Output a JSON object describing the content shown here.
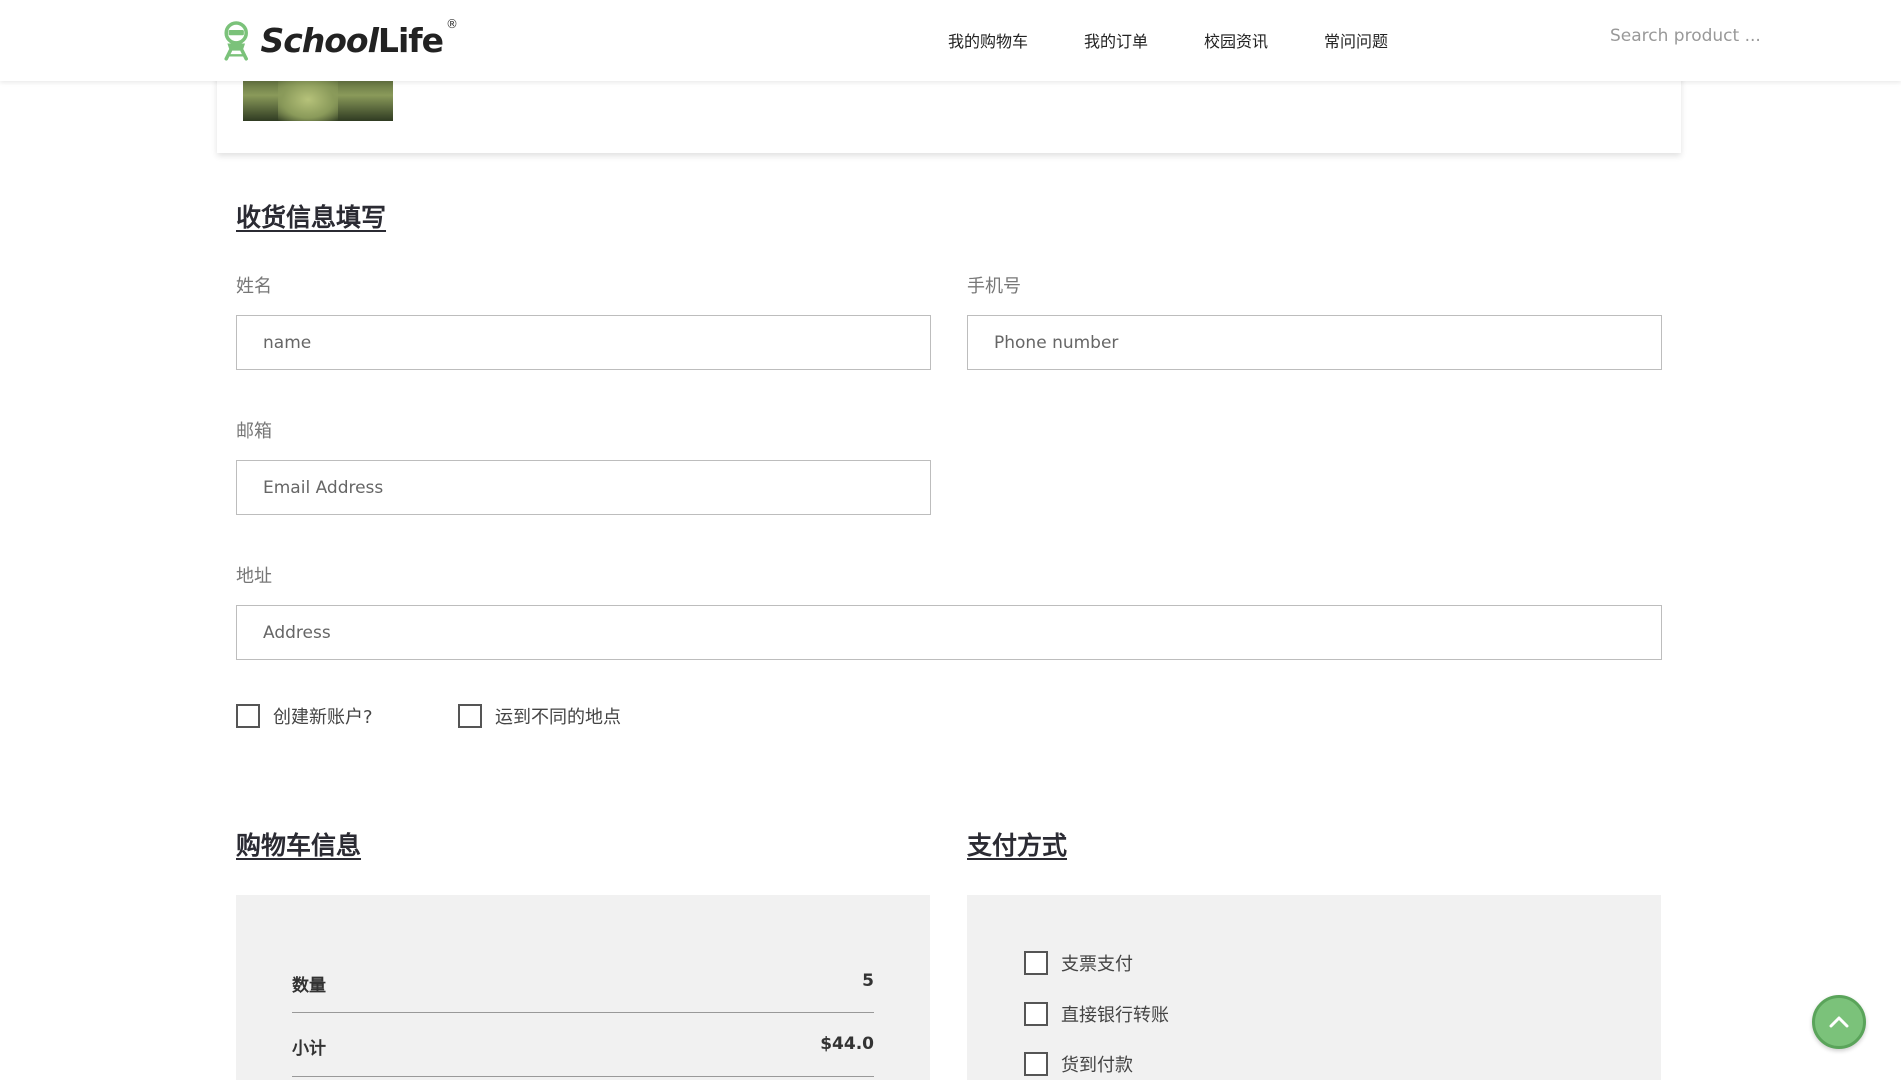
{
  "header": {
    "logo_text_school": "School",
    "logo_text_life": "Life",
    "logo_reg": "®",
    "nav": [
      {
        "label": "我的购物车"
      },
      {
        "label": "我的订单"
      },
      {
        "label": "校园资讯"
      },
      {
        "label": "常问问题"
      }
    ],
    "search_placeholder": "Search product ..."
  },
  "shipping": {
    "title": "收货信息填写",
    "name_label": "姓名",
    "name_placeholder": "name",
    "phone_label": "手机号",
    "phone_placeholder": "Phone number",
    "email_label": "邮箱",
    "email_placeholder": "Email Address",
    "address_label": "地址",
    "address_placeholder": "Address",
    "create_account_label": "创建新账户?",
    "ship_different_label": "运到不同的地点"
  },
  "cart_info": {
    "title": "购物车信息",
    "quantity_label": "数量",
    "quantity_value": "5",
    "subtotal_label": "小计",
    "subtotal_value": "$44.0"
  },
  "payment": {
    "title": "支付方式",
    "options": [
      {
        "label": "支票支付"
      },
      {
        "label": "直接银行转账"
      },
      {
        "label": "货到付款"
      }
    ]
  },
  "colors": {
    "accent_green": "#7bc27a",
    "panel_bg": "#f1f1f1"
  }
}
